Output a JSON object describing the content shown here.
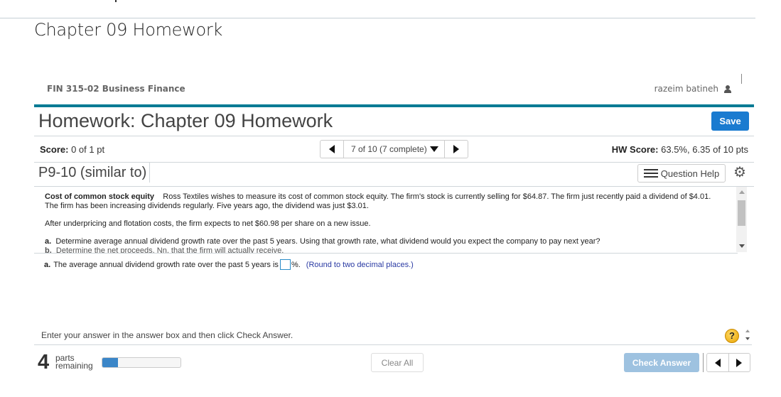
{
  "page": {
    "heading": "Chapter 09 Homework",
    "course_name": "FIN 315-02 Business Finance",
    "user_name": "razeim batineh"
  },
  "header": {
    "title": "Homework: Chapter 09 Homework",
    "save_label": "Save"
  },
  "status": {
    "score_label": "Score:",
    "score_value": "0 of 1 pt",
    "question_nav": "7 of 10 (7 complete)",
    "hw_score_label": "HW Score:",
    "hw_score_value": "63.5%, 6.35 of 10 pts"
  },
  "question": {
    "id": "P9-10 (similar to)",
    "help_label": "Question Help",
    "title": "Cost of common stock equity",
    "para1_body": "Ross Textiles wishes to measure its cost of common stock equity.  The firm's stock is currently selling for $64.87.  The firm just recently paid a dividend of $4.01.  The firm has been increasing dividends regularly.  Five years ago, the dividend was just $3.01.",
    "para2": "After underpricing and flotation costs, the firm expects to net $60.98 per share on a new issue.",
    "part_a_label": "a.",
    "part_a_text": "Determine average annual dividend growth rate over the past 5 years. Using that growth rate, what dividend would you expect the company to pay next year?",
    "part_b_label": "b.",
    "part_b_text": "Determine the net proceeds, Nn, that the firm will actually receive."
  },
  "answer": {
    "label": "a.",
    "prefix": "The average annual dividend growth rate over the past 5 years is",
    "value": "",
    "suffix": "%.",
    "hint": "(Round to two decimal places.)"
  },
  "footer": {
    "instructions": "Enter your answer in the answer box and then click Check Answer.",
    "parts_count": "4",
    "parts_label_1": "parts",
    "parts_label_2": "remaining",
    "progress_fraction": 0.2,
    "clear_label": "Clear All",
    "check_label": "Check Answer"
  },
  "colors": {
    "accent": "#1a7bd0",
    "teal_bar": "#007a94",
    "check_disabled": "#9ec2e0",
    "hint": "#2a3aa3"
  }
}
